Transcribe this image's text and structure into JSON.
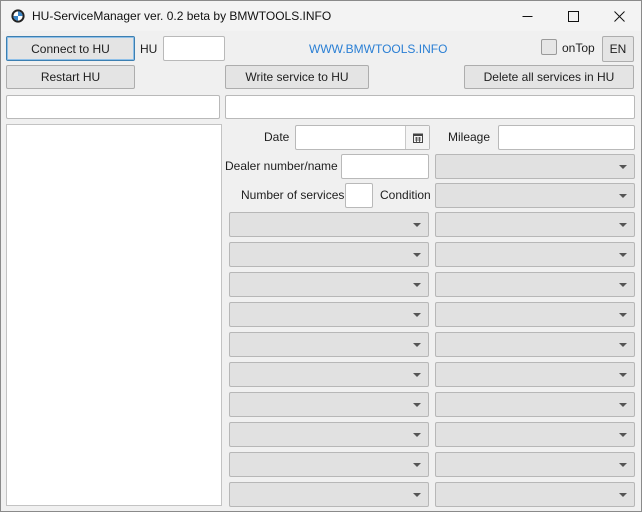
{
  "window": {
    "title": "HU-ServiceManager ver. 0.2 beta by BMWTOOLS.INFO"
  },
  "toolbar": {
    "connect_label": "Connect to HU",
    "hu_label": "HU",
    "hu_value": "",
    "website_link": "WWW.BMWTOOLS.INFO",
    "ontop_label": "onTop",
    "ontop_checked": false,
    "lang_label": "EN",
    "restart_label": "Restart HU",
    "write_label": "Write service to HU",
    "delete_label": "Delete all services in HU"
  },
  "status": {
    "left_value": "",
    "right_value": ""
  },
  "form": {
    "date_label": "Date",
    "date_value": "",
    "mileage_label": "Mileage",
    "mileage_value": "",
    "dealer_label": "Dealer number/name",
    "dealer_value": "",
    "num_services_label": "Number of services",
    "num_services_value": "",
    "condition_label": "Condition"
  },
  "service_rows": [
    {
      "left": "",
      "right": ""
    },
    {
      "left": "",
      "right": ""
    },
    {
      "left": "",
      "right": ""
    },
    {
      "left": "",
      "right": ""
    },
    {
      "left": "",
      "right": ""
    },
    {
      "left": "",
      "right": ""
    },
    {
      "left": "",
      "right": ""
    },
    {
      "left": "",
      "right": ""
    },
    {
      "left": "",
      "right": ""
    },
    {
      "left": "",
      "right": ""
    }
  ],
  "icons": [
    "bmw-logo-icon",
    "minimize-icon",
    "maximize-icon",
    "close-icon",
    "calendar-icon",
    "chevron-down-icon"
  ]
}
